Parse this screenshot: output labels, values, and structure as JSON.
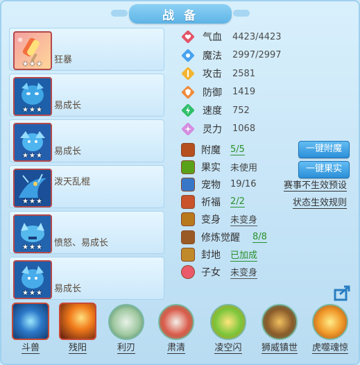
{
  "title": "战 备",
  "skills": [
    {
      "label": "狂暴",
      "stars": "★★★",
      "icon": "ice-pop-icon"
    },
    {
      "label": "易成长",
      "stars": "★★★",
      "icon": "blue-beast-icon"
    },
    {
      "label": "易成长",
      "stars": "★★★",
      "icon": "blue-beast-icon"
    },
    {
      "label": "泼天乱棍",
      "stars": "★★★",
      "icon": "blue-dragon-icon"
    },
    {
      "label": "愤怒、易成长",
      "stars": "★★★",
      "icon": "blue-beast-icon"
    },
    {
      "label": "易成长",
      "stars": "★★★",
      "icon": "blue-beast-icon"
    }
  ],
  "stats": [
    {
      "name": "气血",
      "value": "4423/4423",
      "icon": "heart-icon",
      "color": "#e2556a"
    },
    {
      "name": "魔法",
      "value": "2997/2997",
      "icon": "mana-icon",
      "color": "#4aa3f0"
    },
    {
      "name": "攻击",
      "value": "2581",
      "icon": "attack-icon",
      "color": "#f1b532"
    },
    {
      "name": "防御",
      "value": "1419",
      "icon": "defense-icon",
      "color": "#ef8a3b"
    },
    {
      "name": "速度",
      "value": "752",
      "icon": "speed-icon",
      "color": "#2fbf6a"
    },
    {
      "name": "灵力",
      "value": "1068",
      "icon": "spirit-icon",
      "color": "#d38de0"
    }
  ],
  "props": [
    {
      "name": "附魔",
      "value": "5/5",
      "style": "green",
      "icon": "enchant-icon",
      "color": "#b6501f"
    },
    {
      "name": "果实",
      "value": "未使用",
      "style": "plain",
      "icon": "fruit-icon",
      "color": "#5aa11a"
    },
    {
      "name": "宠物",
      "value": "19/16",
      "style": "plain",
      "icon": "pet-icon",
      "color": "#3877c8"
    },
    {
      "name": "祈福",
      "value": "2/2",
      "style": "green",
      "icon": "pray-icon",
      "color": "#c9522b"
    },
    {
      "name": "变身",
      "value": "未变身",
      "style": "underline",
      "icon": "transform-icon",
      "color": "#b8791d"
    },
    {
      "name": "修炼觉醒",
      "value": "8/8",
      "style": "green",
      "icon": "cultivate-icon",
      "color": "#9a5a25"
    },
    {
      "name": "封地",
      "value": "已加成",
      "style": "green",
      "icon": "fief-icon",
      "color": "#c08a2a"
    },
    {
      "name": "子女",
      "value": "未变身",
      "style": "underline",
      "icon": "child-icon",
      "color": "#ea5a6a"
    }
  ],
  "buttons": {
    "enchant": "一键附魔",
    "fruit": "一键果实"
  },
  "links": {
    "event_preset": "赛事不生效预设",
    "status_rule": "状态生效规则"
  },
  "bottom": [
    {
      "label": "斗兽",
      "icon": "beast-fight-icon",
      "shape": "square"
    },
    {
      "label": "残阳",
      "icon": "sunset-icon",
      "shape": "square"
    },
    {
      "label": "利刃",
      "icon": "blade-icon",
      "shape": "circle"
    },
    {
      "label": "肃清",
      "icon": "purge-icon",
      "shape": "circle"
    },
    {
      "label": "凌空闪",
      "icon": "sky-flash-icon",
      "shape": "circle"
    },
    {
      "label": "狮威镇世",
      "icon": "lion-roar-icon",
      "shape": "circle"
    },
    {
      "label": "虎噬魂惊",
      "icon": "tiger-soul-icon",
      "shape": "circle"
    }
  ]
}
